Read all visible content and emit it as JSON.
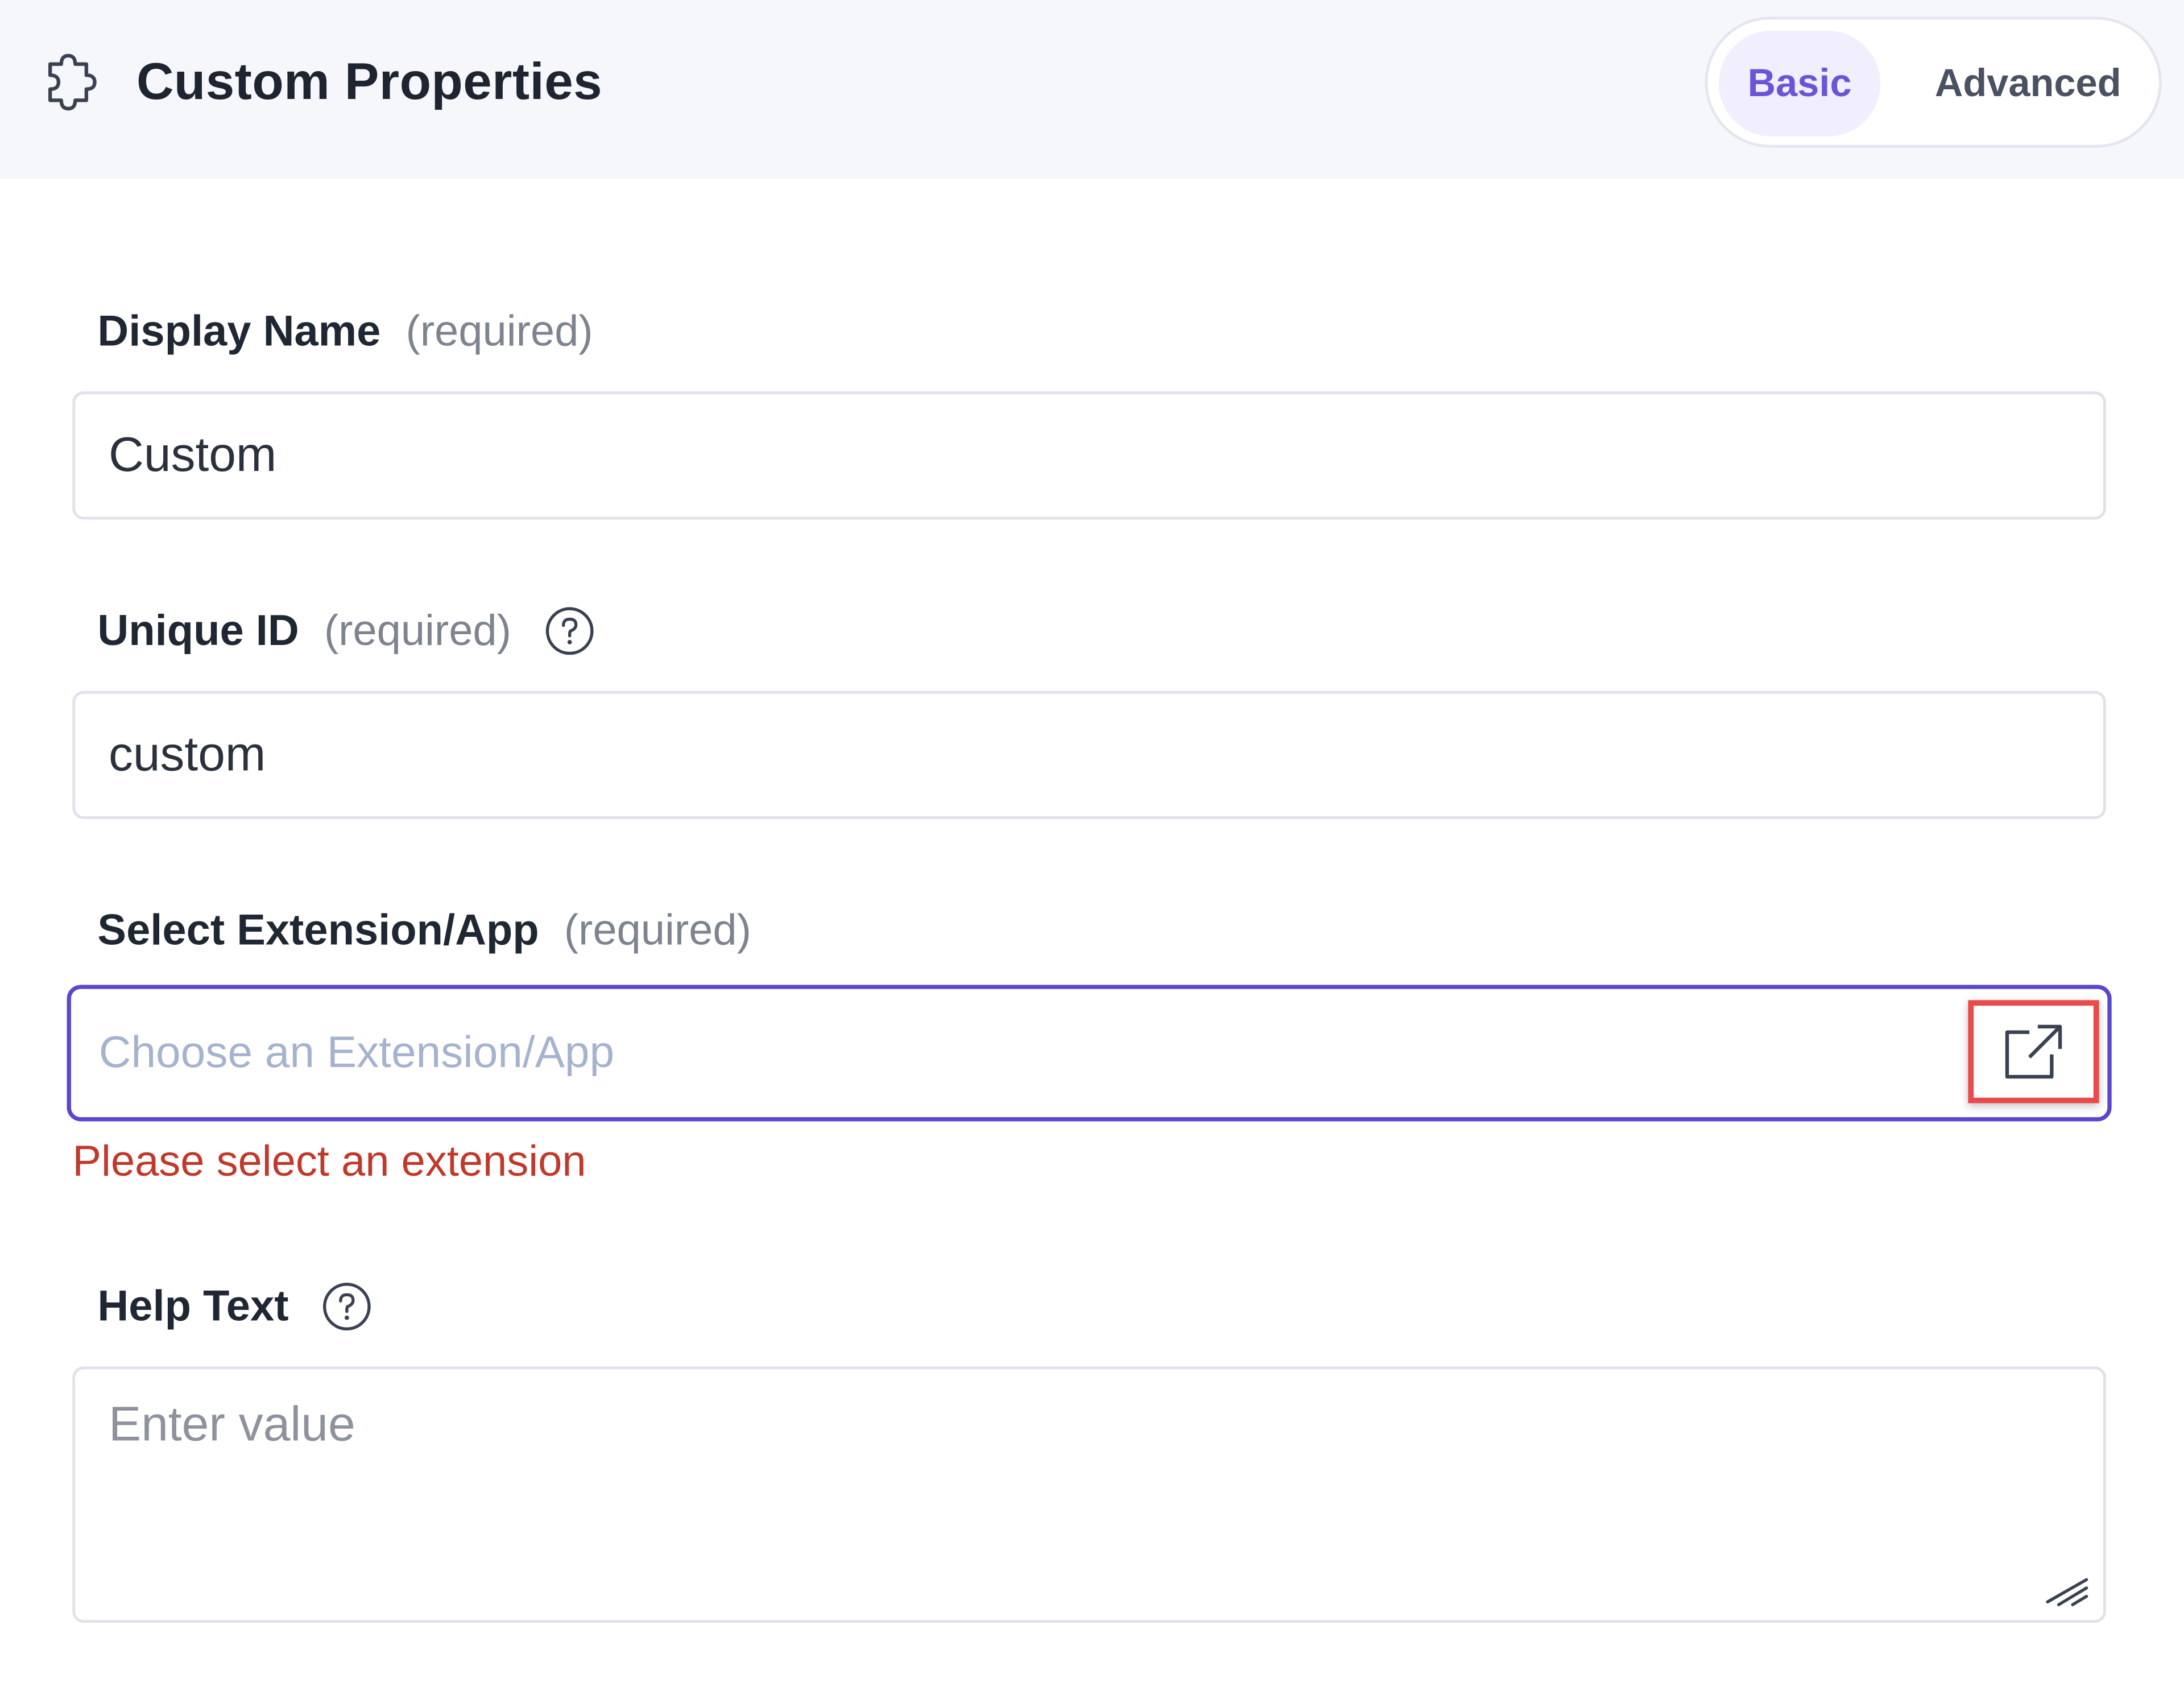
{
  "header": {
    "title": "Custom Properties",
    "icon": "puzzle-piece-icon",
    "modes": {
      "basic": "Basic",
      "advanced": "Advanced",
      "selected": "Basic"
    }
  },
  "form": {
    "display_name": {
      "label": "Display Name",
      "required": "(required)",
      "value": "Custom"
    },
    "unique_id": {
      "label": "Unique ID",
      "required": "(required)",
      "value": "custom",
      "help_icon": "question-circle-icon"
    },
    "extension": {
      "label": "Select Extension/App",
      "required": "(required)",
      "placeholder": "Choose an Extension/App",
      "button_icon": "external-link-icon",
      "error": "Please select an extension"
    },
    "help_text": {
      "label": "Help Text",
      "placeholder": "Enter value",
      "help_icon": "question-circle-icon"
    }
  },
  "colors": {
    "accent": "#5a47d0",
    "error": "#c0392b",
    "highlight_box": "#e94b4b"
  }
}
